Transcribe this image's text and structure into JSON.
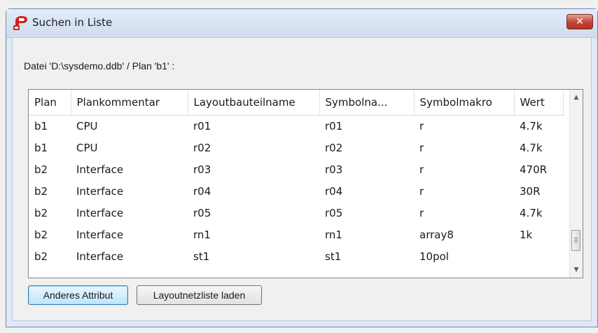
{
  "window": {
    "title": "Suchen in Liste",
    "close_label": "✕"
  },
  "path_label": "Datei 'D:\\sysdemo.ddb' / Plan 'b1' :",
  "table": {
    "columns": [
      "Plan",
      "Plankommentar",
      "Layoutbauteilname",
      "Symbolna...",
      "Symbolmakro",
      "Wert"
    ],
    "rows": [
      [
        "b1",
        "CPU",
        "r01",
        "r01",
        "r",
        "4.7k"
      ],
      [
        "b1",
        "CPU",
        "r02",
        "r02",
        "r",
        "4.7k"
      ],
      [
        "b2",
        "Interface",
        "r03",
        "r03",
        "r",
        "470R"
      ],
      [
        "b2",
        "Interface",
        "r04",
        "r04",
        "r",
        "30R"
      ],
      [
        "b2",
        "Interface",
        "r05",
        "r05",
        "r",
        "4.7k"
      ],
      [
        "b2",
        "Interface",
        "rn1",
        "rn1",
        "array8",
        "1k"
      ],
      [
        "b2",
        "Interface",
        "st1",
        "st1",
        "10pol",
        ""
      ]
    ]
  },
  "buttons": {
    "anderes": "Anderes Attribut",
    "layout": "Layoutnetzliste laden"
  },
  "colors": {
    "close_button": "#c6473a",
    "default_button_border": "#3c7fb1",
    "app_icon": "#d02020"
  }
}
